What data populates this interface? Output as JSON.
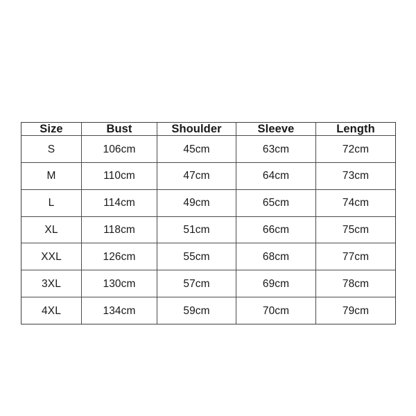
{
  "page": {
    "background_color": "#ffffff",
    "text_color": "#181818",
    "border_color": "#4a4a4a"
  },
  "table": {
    "name": "size-chart",
    "columns": [
      "Size",
      "Bust",
      "Shoulder",
      "Sleeve",
      "Length"
    ],
    "rows": [
      {
        "size": "S",
        "bust": "106cm",
        "shoulder": "45cm",
        "sleeve": "63cm",
        "length": "72cm"
      },
      {
        "size": "M",
        "bust": "110cm",
        "shoulder": "47cm",
        "sleeve": "64cm",
        "length": "73cm"
      },
      {
        "size": "L",
        "bust": "114cm",
        "shoulder": "49cm",
        "sleeve": "65cm",
        "length": "74cm"
      },
      {
        "size": "XL",
        "bust": "118cm",
        "shoulder": "51cm",
        "sleeve": "66cm",
        "length": "75cm"
      },
      {
        "size": "XXL",
        "bust": "126cm",
        "shoulder": "55cm",
        "sleeve": "68cm",
        "length": "77cm"
      },
      {
        "size": "3XL",
        "bust": "130cm",
        "shoulder": "57cm",
        "sleeve": "69cm",
        "length": "78cm"
      },
      {
        "size": "4XL",
        "bust": "134cm",
        "shoulder": "59cm",
        "sleeve": "70cm",
        "length": "79cm"
      }
    ]
  },
  "chart_data": {
    "type": "table",
    "title": "",
    "columns": [
      "Size",
      "Bust",
      "Shoulder",
      "Sleeve",
      "Length"
    ],
    "units": "cm",
    "categories": [
      "S",
      "M",
      "L",
      "XL",
      "XXL",
      "3XL",
      "4XL"
    ],
    "series": [
      {
        "name": "Bust",
        "values": [
          106,
          110,
          114,
          118,
          126,
          130,
          134
        ]
      },
      {
        "name": "Shoulder",
        "values": [
          45,
          47,
          49,
          51,
          55,
          57,
          59
        ]
      },
      {
        "name": "Sleeve",
        "values": [
          63,
          64,
          65,
          66,
          68,
          69,
          70
        ]
      },
      {
        "name": "Length",
        "values": [
          72,
          73,
          74,
          75,
          77,
          78,
          79
        ]
      }
    ],
    "rows": [
      [
        "S",
        "106cm",
        "45cm",
        "63cm",
        "72cm"
      ],
      [
        "M",
        "110cm",
        "47cm",
        "64cm",
        "73cm"
      ],
      [
        "L",
        "114cm",
        "49cm",
        "65cm",
        "74cm"
      ],
      [
        "XL",
        "118cm",
        "51cm",
        "66cm",
        "75cm"
      ],
      [
        "XXL",
        "126cm",
        "55cm",
        "68cm",
        "77cm"
      ],
      [
        "3XL",
        "130cm",
        "57cm",
        "69cm",
        "78cm"
      ],
      [
        "4XL",
        "134cm",
        "59cm",
        "70cm",
        "79cm"
      ]
    ]
  }
}
